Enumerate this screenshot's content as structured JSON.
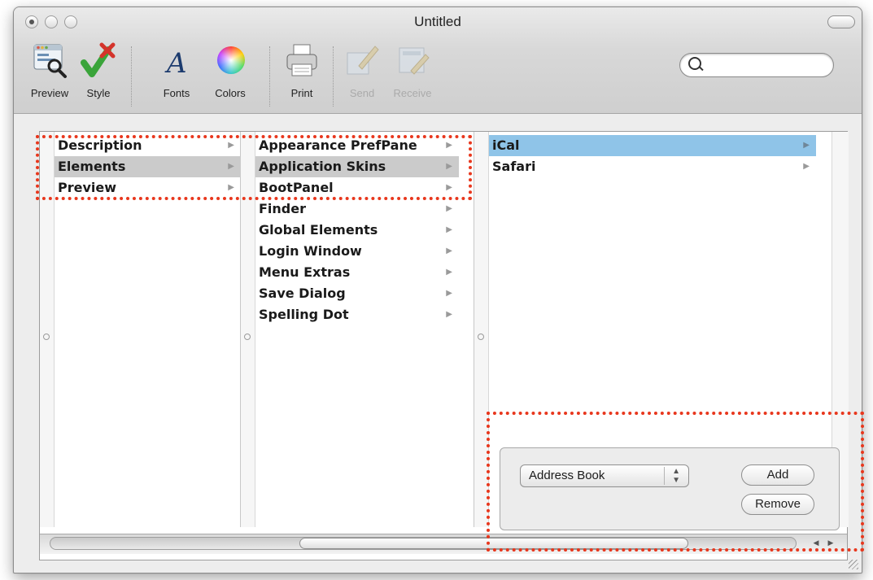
{
  "window": {
    "title": "Untitled"
  },
  "toolbar": [
    {
      "label": "Preview",
      "icon": "preview-icon",
      "enabled": true
    },
    {
      "label": "Style",
      "icon": "style-checkmark-icon",
      "enabled": true
    },
    {
      "label": "Fonts",
      "icon": "fonts-icon",
      "enabled": true
    },
    {
      "label": "Colors",
      "icon": "color-wheel-icon",
      "enabled": true
    },
    {
      "label": "Print",
      "icon": "printer-icon",
      "enabled": true
    },
    {
      "label": "Send",
      "icon": "send-icon",
      "enabled": false
    },
    {
      "label": "Receive",
      "icon": "receive-icon",
      "enabled": false
    }
  ],
  "search": {
    "placeholder": ""
  },
  "columns": {
    "col1": [
      {
        "label": "Description",
        "selected": false
      },
      {
        "label": "Elements",
        "selected": true
      },
      {
        "label": "Preview",
        "selected": false
      }
    ],
    "col2": [
      {
        "label": "Appearance PrefPane",
        "selected": false
      },
      {
        "label": "Application Skins",
        "selected": true
      },
      {
        "label": "BootPanel",
        "selected": false
      },
      {
        "label": "Finder",
        "selected": false
      },
      {
        "label": "Global Elements",
        "selected": false
      },
      {
        "label": "Login Window",
        "selected": false
      },
      {
        "label": "Menu Extras",
        "selected": false
      },
      {
        "label": "Save Dialog",
        "selected": false
      },
      {
        "label": "Spelling Dot",
        "selected": false
      }
    ],
    "col3": [
      {
        "label": "iCal",
        "selected": true
      },
      {
        "label": "Safari",
        "selected": false
      }
    ]
  },
  "panel": {
    "popup_value": "Address Book",
    "add_label": "Add",
    "remove_label": "Remove"
  },
  "colors": {
    "highlight": "#e8371d",
    "selection_blue": "#8fc4e8",
    "selection_gray": "#cbcbcb"
  }
}
